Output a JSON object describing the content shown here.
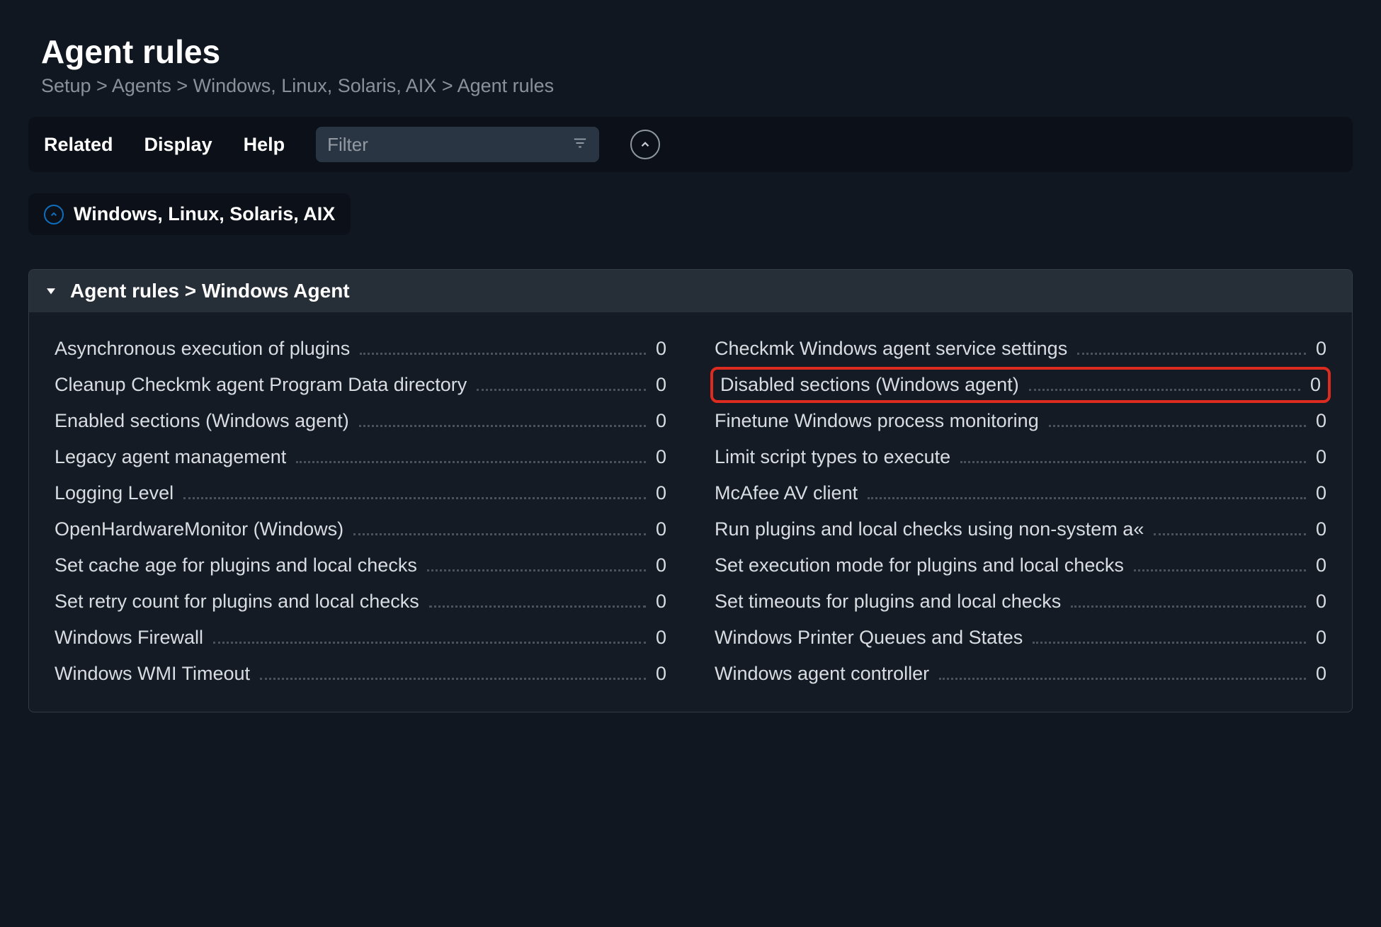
{
  "page_title": "Agent rules",
  "breadcrumb": "Setup > Agents > Windows, Linux, Solaris, AIX > Agent rules",
  "toolbar": {
    "related": "Related",
    "display": "Display",
    "help": "Help",
    "filter_placeholder": "Filter"
  },
  "parent_chip": "Windows, Linux, Solaris, AIX",
  "section": {
    "title": "Agent rules > Windows Agent",
    "items": [
      {
        "label": "Asynchronous execution of plugins",
        "count": 0,
        "highlight": false
      },
      {
        "label": "Checkmk Windows agent service settings",
        "count": 0,
        "highlight": false
      },
      {
        "label": "Cleanup Checkmk agent Program Data directory",
        "count": 0,
        "highlight": false
      },
      {
        "label": "Disabled sections (Windows agent)",
        "count": 0,
        "highlight": true
      },
      {
        "label": "Enabled sections (Windows agent)",
        "count": 0,
        "highlight": false
      },
      {
        "label": "Finetune Windows process monitoring",
        "count": 0,
        "highlight": false
      },
      {
        "label": "Legacy agent management",
        "count": 0,
        "highlight": false
      },
      {
        "label": "Limit script types to execute",
        "count": 0,
        "highlight": false
      },
      {
        "label": "Logging Level",
        "count": 0,
        "highlight": false
      },
      {
        "label": "McAfee AV client",
        "count": 0,
        "highlight": false
      },
      {
        "label": "OpenHardwareMonitor (Windows)",
        "count": 0,
        "highlight": false
      },
      {
        "label": "Run plugins and local checks using non-system a«",
        "count": 0,
        "highlight": false
      },
      {
        "label": "Set cache age for plugins and local checks",
        "count": 0,
        "highlight": false
      },
      {
        "label": "Set execution mode for plugins and local checks",
        "count": 0,
        "highlight": false
      },
      {
        "label": "Set retry count for plugins and local checks",
        "count": 0,
        "highlight": false
      },
      {
        "label": "Set timeouts for plugins and local checks",
        "count": 0,
        "highlight": false
      },
      {
        "label": "Windows Firewall",
        "count": 0,
        "highlight": false
      },
      {
        "label": "Windows Printer Queues and States",
        "count": 0,
        "highlight": false
      },
      {
        "label": "Windows WMI Timeout",
        "count": 0,
        "highlight": false
      },
      {
        "label": "Windows agent controller",
        "count": 0,
        "highlight": false
      }
    ]
  }
}
